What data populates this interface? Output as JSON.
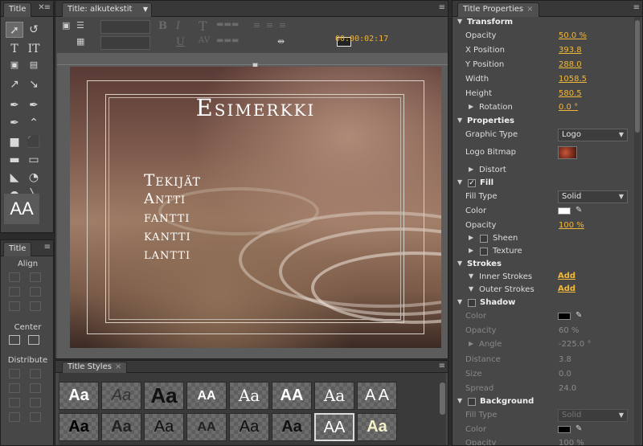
{
  "tools_panel": {
    "tab": "Title",
    "aa_label": "AA"
  },
  "actions_panel": {
    "tab": "Title",
    "align": "Align",
    "center": "Center",
    "distribute": "Distribute"
  },
  "main_panel": {
    "tab": "Title: alkutekstit",
    "timecode": "00:00:02:17"
  },
  "canvas": {
    "title": "Esimerkki",
    "credits_heading": "Tekijät",
    "credits": [
      "Antti",
      "fantti",
      "kantti",
      "lantti"
    ]
  },
  "styles_panel": {
    "tab": "Title Styles",
    "swatches": [
      "Aa",
      "Aa",
      "Aa",
      "AA",
      "Aa",
      "AA",
      "Aa",
      "A A",
      "Aa",
      "Aa",
      "Aa",
      "AA",
      "Aa",
      "Aa",
      "AA",
      "Aa"
    ]
  },
  "props": {
    "tab": "Title Properties",
    "transform": "Transform",
    "opacity_lbl": "Opacity",
    "opacity": "50.0",
    "pct": "%",
    "xpos_lbl": "X Position",
    "xpos": "393.8",
    "ypos_lbl": "Y Position",
    "ypos": "288.0",
    "width_lbl": "Width",
    "width": "1058.5",
    "height_lbl": "Height",
    "height": "580.5",
    "rotation_lbl": "Rotation",
    "rotation": "0.0",
    "deg": "°",
    "properties": "Properties",
    "graphic_type_lbl": "Graphic Type",
    "graphic_type": "Logo",
    "logo_bitmap_lbl": "Logo Bitmap",
    "distort": "Distort",
    "fill": "Fill",
    "fill_type_lbl": "Fill Type",
    "fill_type": "Solid",
    "color_lbl": "Color",
    "fill_opacity": "100",
    "sheen": "Sheen",
    "texture": "Texture",
    "strokes": "Strokes",
    "inner_strokes": "Inner Strokes",
    "outer_strokes": "Outer Strokes",
    "add": "Add",
    "shadow": "Shadow",
    "shadow_opacity": "60",
    "angle_lbl": "Angle",
    "angle": "-225.0",
    "distance_lbl": "Distance",
    "distance": "3.8",
    "size_lbl": "Size",
    "size": "0.0",
    "spread_lbl": "Spread",
    "spread": "24.0",
    "background": "Background",
    "bg_fill_type": "Solid",
    "bg_opacity": "100"
  },
  "colors": {
    "accent": "#f2b83a",
    "fill_color": "#ffffff",
    "shadow_color": "#000000"
  }
}
